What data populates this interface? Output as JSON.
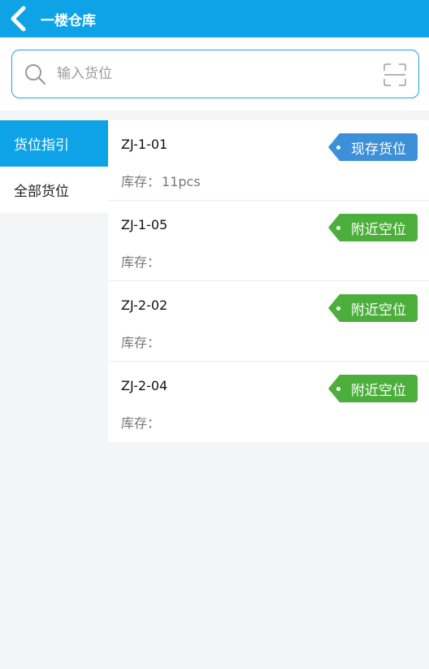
{
  "header": {
    "title": "一楼仓库",
    "back_icon": "chevron-left-icon"
  },
  "search": {
    "placeholder": "输入货位",
    "value": "",
    "search_icon": "search-icon",
    "scan_icon": "scan-icon"
  },
  "sidebar": {
    "items": [
      {
        "label": "货位指引",
        "active": true
      },
      {
        "label": "全部货位",
        "active": false
      }
    ]
  },
  "list": {
    "stock_label": "库存：",
    "rows": [
      {
        "code": "ZJ-1-01",
        "stock": "11pcs",
        "tag": "现存货位",
        "tag_color": "#3d8fd8"
      },
      {
        "code": "ZJ-1-05",
        "stock": "",
        "tag": "附近空位",
        "tag_color": "#4caf3c"
      },
      {
        "code": "ZJ-2-02",
        "stock": "",
        "tag": "附近空位",
        "tag_color": "#4caf3c"
      },
      {
        "code": "ZJ-2-04",
        "stock": "",
        "tag": "附近空位",
        "tag_color": "#4caf3c"
      }
    ]
  },
  "colors": {
    "primary": "#0ea3e6",
    "tag_blue": "#3d8fd8",
    "tag_green": "#4caf3c",
    "background": "#f4f5f7"
  }
}
